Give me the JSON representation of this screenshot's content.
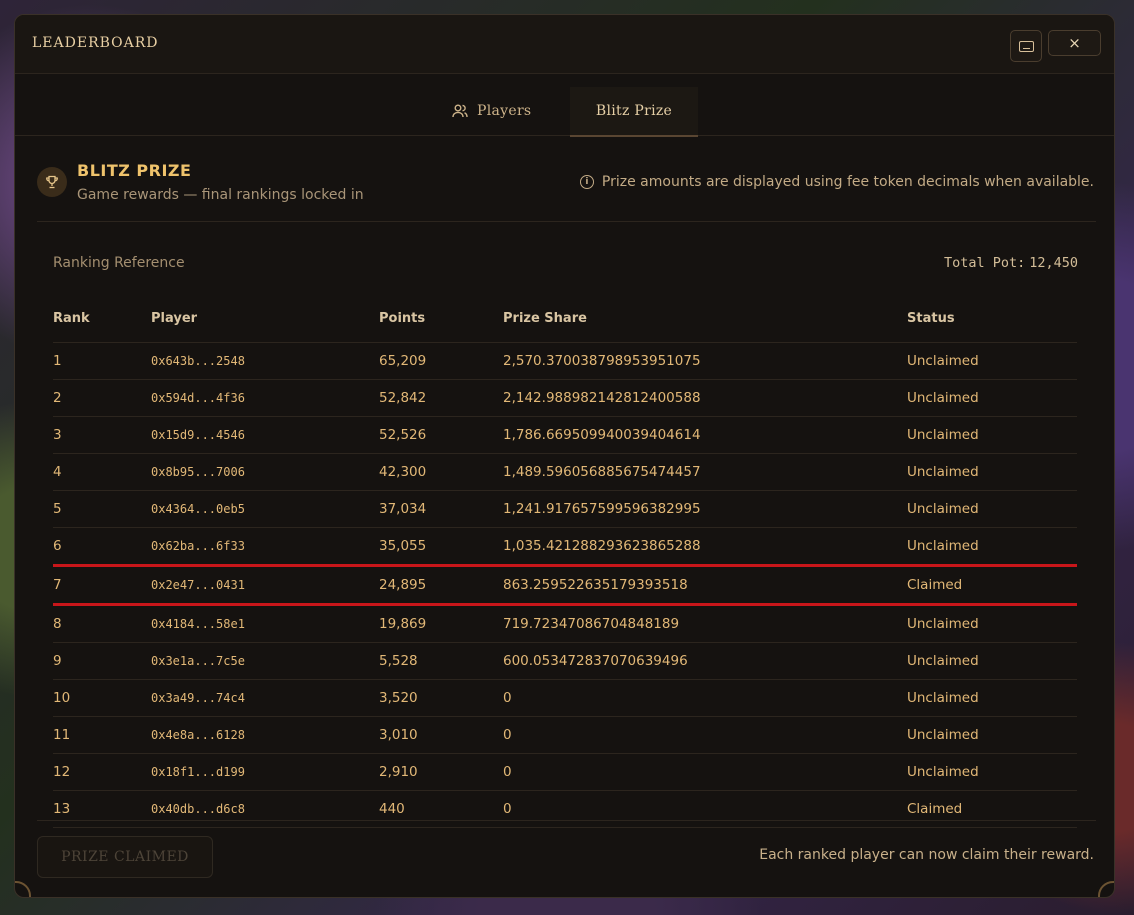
{
  "window": {
    "title": "LEADERBOARD",
    "close_label": "×"
  },
  "tabs": [
    {
      "label": "Players",
      "icon": "users-icon",
      "active": false
    },
    {
      "label": "Blitz Prize",
      "active": true
    }
  ],
  "prize": {
    "title": "BLITZ PRIZE",
    "subtitle": "Game rewards — final rankings locked in",
    "info": "Prize amounts are displayed using fee token decimals when available.",
    "icon": "trophy-icon"
  },
  "ranking": {
    "reference_label": "Ranking Reference",
    "total_pot_label": "Total Pot:",
    "total_pot_value": "12,450"
  },
  "table": {
    "columns": [
      "Rank",
      "Player",
      "Points",
      "Prize Share",
      "Status"
    ],
    "rows": [
      {
        "rank": "1",
        "player": "0x643b...2548",
        "points": "65,209",
        "share": "2,570.370038798953951075",
        "status": "Unclaimed"
      },
      {
        "rank": "2",
        "player": "0x594d...4f36",
        "points": "52,842",
        "share": "2,142.988982142812400588",
        "status": "Unclaimed"
      },
      {
        "rank": "3",
        "player": "0x15d9...4546",
        "points": "52,526",
        "share": "1,786.669509940039404614",
        "status": "Unclaimed"
      },
      {
        "rank": "4",
        "player": "0x8b95...7006",
        "points": "42,300",
        "share": "1,489.596056885675474457",
        "status": "Unclaimed"
      },
      {
        "rank": "5",
        "player": "0x4364...0eb5",
        "points": "37,034",
        "share": "1,241.917657599596382995",
        "status": "Unclaimed"
      },
      {
        "rank": "6",
        "player": "0x62ba...6f33",
        "points": "35,055",
        "share": "1,035.421288293623865288",
        "status": "Unclaimed"
      },
      {
        "rank": "7",
        "player": "0x2e47...0431",
        "points": "24,895",
        "share": "863.259522635179393518",
        "status": "Claimed"
      },
      {
        "rank": "8",
        "player": "0x4184...58e1",
        "points": "19,869",
        "share": "719.72347086704848189",
        "status": "Unclaimed"
      },
      {
        "rank": "9",
        "player": "0x3e1a...7c5e",
        "points": "5,528",
        "share": "600.053472837070639496",
        "status": "Unclaimed"
      },
      {
        "rank": "10",
        "player": "0x3a49...74c4",
        "points": "3,520",
        "share": "0",
        "status": "Unclaimed"
      },
      {
        "rank": "11",
        "player": "0x4e8a...6128",
        "points": "3,010",
        "share": "0",
        "status": "Unclaimed"
      },
      {
        "rank": "12",
        "player": "0x18f1...d199",
        "points": "2,910",
        "share": "0",
        "status": "Unclaimed"
      },
      {
        "rank": "13",
        "player": "0x40db...d6c8",
        "points": "440",
        "share": "0",
        "status": "Claimed"
      }
    ],
    "highlight_rank": "7"
  },
  "footer": {
    "button_label": "PRIZE CLAIMED",
    "note": "Each ranked player can now claim their reward."
  },
  "colors": {
    "accent": "#efc36c",
    "cell_text": "#e2b877",
    "highlight": "#c8161a",
    "background": "#151210"
  }
}
